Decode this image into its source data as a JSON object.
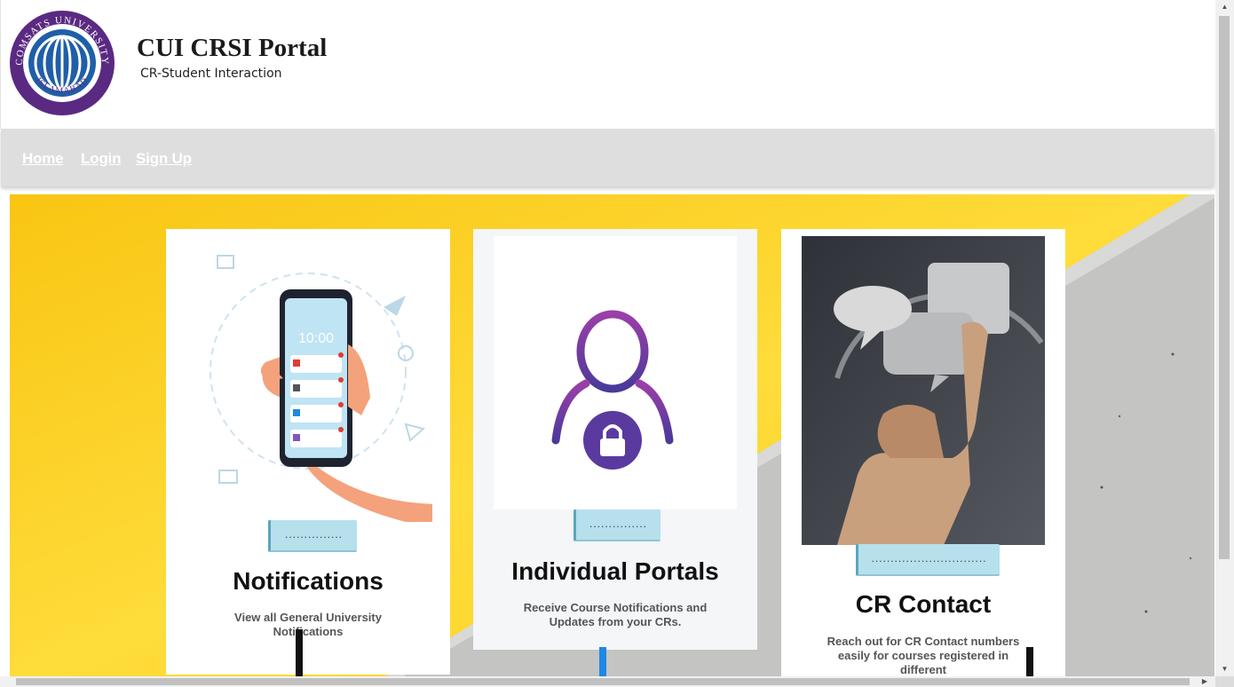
{
  "header": {
    "logo_text_top": "COMSATS UNIVERSITY",
    "logo_text_bottom": "ISLAMABAD",
    "title": "CUI CRSI Portal",
    "subtitle": "CR-Student Interaction"
  },
  "nav": {
    "items": [
      {
        "label": "Home"
      },
      {
        "label": "Login"
      },
      {
        "label": "Sign Up"
      }
    ]
  },
  "cards": [
    {
      "button_label": "...............",
      "title": "Notifications",
      "description": "View all General University Notifications",
      "illustration": "phone-notifications-illustration",
      "phone_time": "10:00"
    },
    {
      "button_label": "...............",
      "title": "Individual Portals",
      "description": "Receive Course Notifications and Updates from your CRs.",
      "illustration": "user-lock-icon"
    },
    {
      "button_label": "..............................",
      "title": "CR Contact",
      "description": "Reach out for CR Contact numbers easily for courses registered in different",
      "illustration": "chat-bubbles-hand-photo"
    }
  ],
  "colors": {
    "nav_bg": "#dedede",
    "hero_yellow": "#fdd835",
    "pill_bg": "#b6e0ec",
    "portal_purple": "#7b3fa0",
    "accent_blue": "#1e88e5"
  }
}
